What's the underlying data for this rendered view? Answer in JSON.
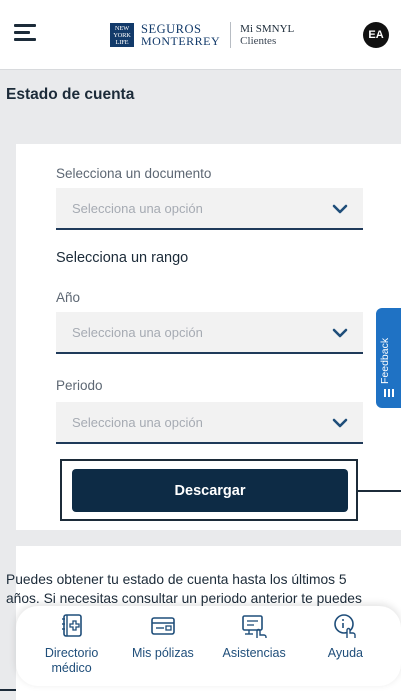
{
  "header": {
    "brand_line1": "SEGUROS",
    "brand_line2": "MONTERREY",
    "logo_mark": "NEW YORK LIFE",
    "app_line1": "Mi SMNYL",
    "app_line2": "Clientes",
    "avatar_initials": "EA"
  },
  "page": {
    "title": "Estado de cuenta"
  },
  "form": {
    "document_label": "Selecciona un documento",
    "document_placeholder": "Selecciona una opción",
    "range_label": "Selecciona un rango",
    "year_label": "Año",
    "year_placeholder": "Selecciona una opción",
    "period_label": "Periodo",
    "period_placeholder": "Selecciona una opción",
    "download_label": "Descargar"
  },
  "feedback": {
    "label": "Feedback"
  },
  "info": {
    "line1": "Puedes obtener tu estado de cuenta hasta los últimos 5",
    "line2": "años. Si necesitas consultar un periodo anterior te puedes"
  },
  "bottom_nav": {
    "items": [
      {
        "label": "Directorio médico",
        "icon": "medical-book-icon"
      },
      {
        "label": "Mis pólizas",
        "icon": "card-icon"
      },
      {
        "label": "Asistencias",
        "icon": "computer-hand-icon"
      },
      {
        "label": "Ayuda",
        "icon": "help-hand-icon"
      }
    ]
  },
  "colors": {
    "primary": "#0d2b45",
    "accent": "#1f72c4",
    "background": "#e9eaec"
  }
}
